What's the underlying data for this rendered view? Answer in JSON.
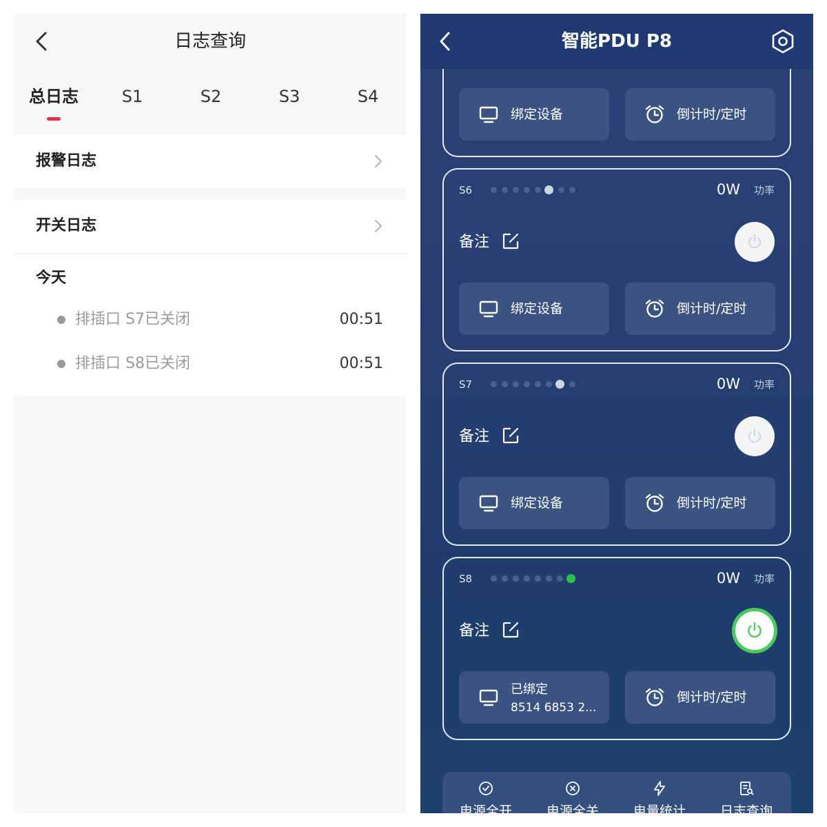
{
  "left": {
    "title": "日志查询",
    "tabs": [
      "总日志",
      "S1",
      "S2",
      "S3",
      "S4"
    ],
    "active_tab": "总日志",
    "accent_color": "#e8324a",
    "rows": [
      "报警日志",
      "开关日志"
    ],
    "today_label": "今天",
    "logs": [
      {
        "text": "排插口 S7已关闭",
        "time": "00:51"
      },
      {
        "text": "排插口 S8已关闭",
        "time": "00:51"
      }
    ]
  },
  "right": {
    "title": "智能PDU P8",
    "top_card": {
      "bind_label": "绑定设备",
      "timer_label": "倒计时/定时"
    },
    "cards": [
      {
        "slot": "S6",
        "power": "0W",
        "power_label": "功率",
        "note": "备注",
        "state": "off",
        "bind_label": "绑定设备",
        "timer_label": "倒计时/定时"
      },
      {
        "slot": "S7",
        "power": "0W",
        "power_label": "功率",
        "note": "备注",
        "state": "off",
        "bind_label": "绑定设备",
        "timer_label": "倒计时/定时"
      },
      {
        "slot": "S8",
        "power": "0W",
        "power_label": "功率",
        "note": "备注",
        "state": "on",
        "bind_status": "已绑定",
        "bind_device": "8514 6853 2...",
        "timer_label": "倒计时/定时"
      }
    ],
    "bottom_bar": [
      "电源全开",
      "电源全关",
      "电量统计",
      "日志查询"
    ],
    "on_color": "#4ccb5c"
  }
}
